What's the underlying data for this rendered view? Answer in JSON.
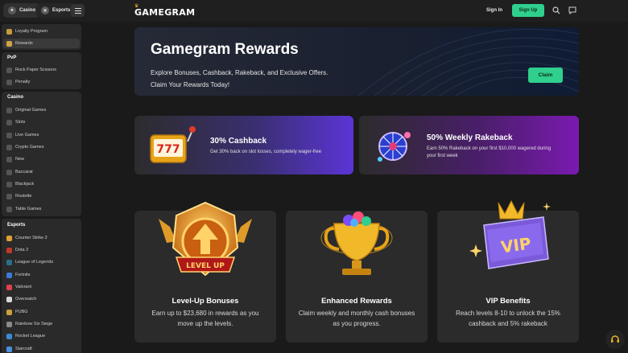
{
  "topbar": {
    "casino_label": "Casino",
    "esports_label": "Esports",
    "logo": "GAMEGRAM",
    "signin": "Sign In",
    "signup": "Sign Up"
  },
  "sidebar": {
    "top_items": [
      {
        "label": "Loyalty Program",
        "icon": "trophy-icon"
      },
      {
        "label": "Rewards",
        "icon": "gift-icon"
      }
    ],
    "pvp": {
      "title": "PvP",
      "items": [
        {
          "label": "Rock Paper Scissors",
          "icon": "hand-icon"
        },
        {
          "label": "Penalty",
          "icon": "ball-icon"
        }
      ]
    },
    "casino": {
      "title": "Casino",
      "items": [
        {
          "label": "Original Games",
          "icon": "star-icon"
        },
        {
          "label": "Slots",
          "icon": "slot-icon"
        },
        {
          "label": "Live Games",
          "icon": "live-icon"
        },
        {
          "label": "Crypto Games",
          "icon": "coin-icon"
        },
        {
          "label": "New",
          "icon": "new-icon"
        },
        {
          "label": "Baccarat",
          "icon": "cards-icon"
        },
        {
          "label": "Blackjack",
          "icon": "blackjack-icon"
        },
        {
          "label": "Roulette",
          "icon": "roulette-icon"
        },
        {
          "label": "Table Games",
          "icon": "table-icon"
        }
      ]
    },
    "esports": {
      "title": "Esports",
      "items": [
        {
          "label": "Counter Strike 2",
          "icon": "cs2-icon"
        },
        {
          "label": "Dota 2",
          "icon": "dota2-icon"
        },
        {
          "label": "League of Legends",
          "icon": "lol-icon"
        },
        {
          "label": "Fortnite",
          "icon": "fortnite-icon"
        },
        {
          "label": "Valorant",
          "icon": "valorant-icon"
        },
        {
          "label": "Overwatch",
          "icon": "overwatch-icon"
        },
        {
          "label": "PUBG",
          "icon": "pubg-icon"
        },
        {
          "label": "Rainbow Six Siege",
          "icon": "r6-icon"
        },
        {
          "label": "Rocket League",
          "icon": "rocket-league-icon"
        },
        {
          "label": "Starcraft",
          "icon": "starcraft-icon"
        }
      ]
    }
  },
  "hero": {
    "title": "Gamegram Rewards",
    "subtitle_line1": "Explore Bonuses, Cashback, Rakeback, and Exclusive Offers.",
    "subtitle_line2": "Claim Your Rewards Today!",
    "claim": "Claim"
  },
  "promos": [
    {
      "title": "30% Cashback",
      "desc": "Get 30% back on slot losses, completely wager-free",
      "badge": "777"
    },
    {
      "title": "50% Weekly Rakeback",
      "desc_line1": "Earn 50% Rakeback on your first $10,000 wagered during",
      "desc_line2": "your first week"
    }
  ],
  "cards": [
    {
      "title": "Level-Up Bonuses",
      "desc": "Earn up to $23,680 in rewards as you move up the levels.",
      "badge": "LEVEL UP"
    },
    {
      "title": "Enhanced Rewards",
      "desc": "Claim weekly and monthly cash bonuses as you progress."
    },
    {
      "title": "VIP Benefits",
      "desc": "Reach levels 8-10 to unlock the 15% cashback and 5% rakeback",
      "badge": "VIP"
    }
  ],
  "colors": {
    "accent": "#2fcf8e",
    "bg": "#1a1a1a",
    "card": "#2b2b2b"
  }
}
